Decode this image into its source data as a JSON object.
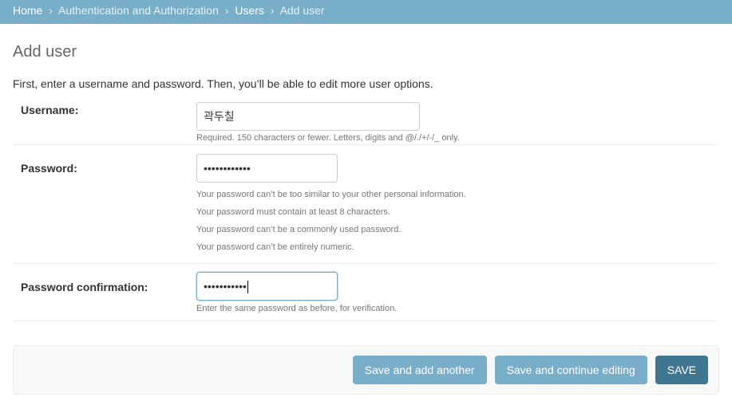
{
  "breadcrumbs": {
    "home": "Home",
    "app": "Authentication and Authorization",
    "model": "Users",
    "current": "Add user",
    "separator": "›"
  },
  "page": {
    "title": "Add user",
    "intro": "First, enter a username and password. Then, you’ll be able to edit more user options."
  },
  "form": {
    "username": {
      "label": "Username:",
      "value": "곽두칠",
      "help": "Required. 150 characters or fewer. Letters, digits and @/./+/-/_ only."
    },
    "password": {
      "label": "Password:",
      "masked_value": "••••••••••••",
      "help": [
        "Your password can’t be too similar to your other personal information.",
        "Your password must contain at least 8 characters.",
        "Your password can’t be a commonly used password.",
        "Your password can’t be entirely numeric."
      ]
    },
    "password_confirmation": {
      "label": "Password confirmation:",
      "masked_value": "•••••••••••",
      "help": "Enter the same password as before, for verification."
    }
  },
  "actions": {
    "save_add_another": "Save and add another",
    "save_continue": "Save and continue editing",
    "save": "SAVE"
  },
  "colors": {
    "header": "#79aec8",
    "button": "#79aec8",
    "primary_button": "#417690"
  }
}
